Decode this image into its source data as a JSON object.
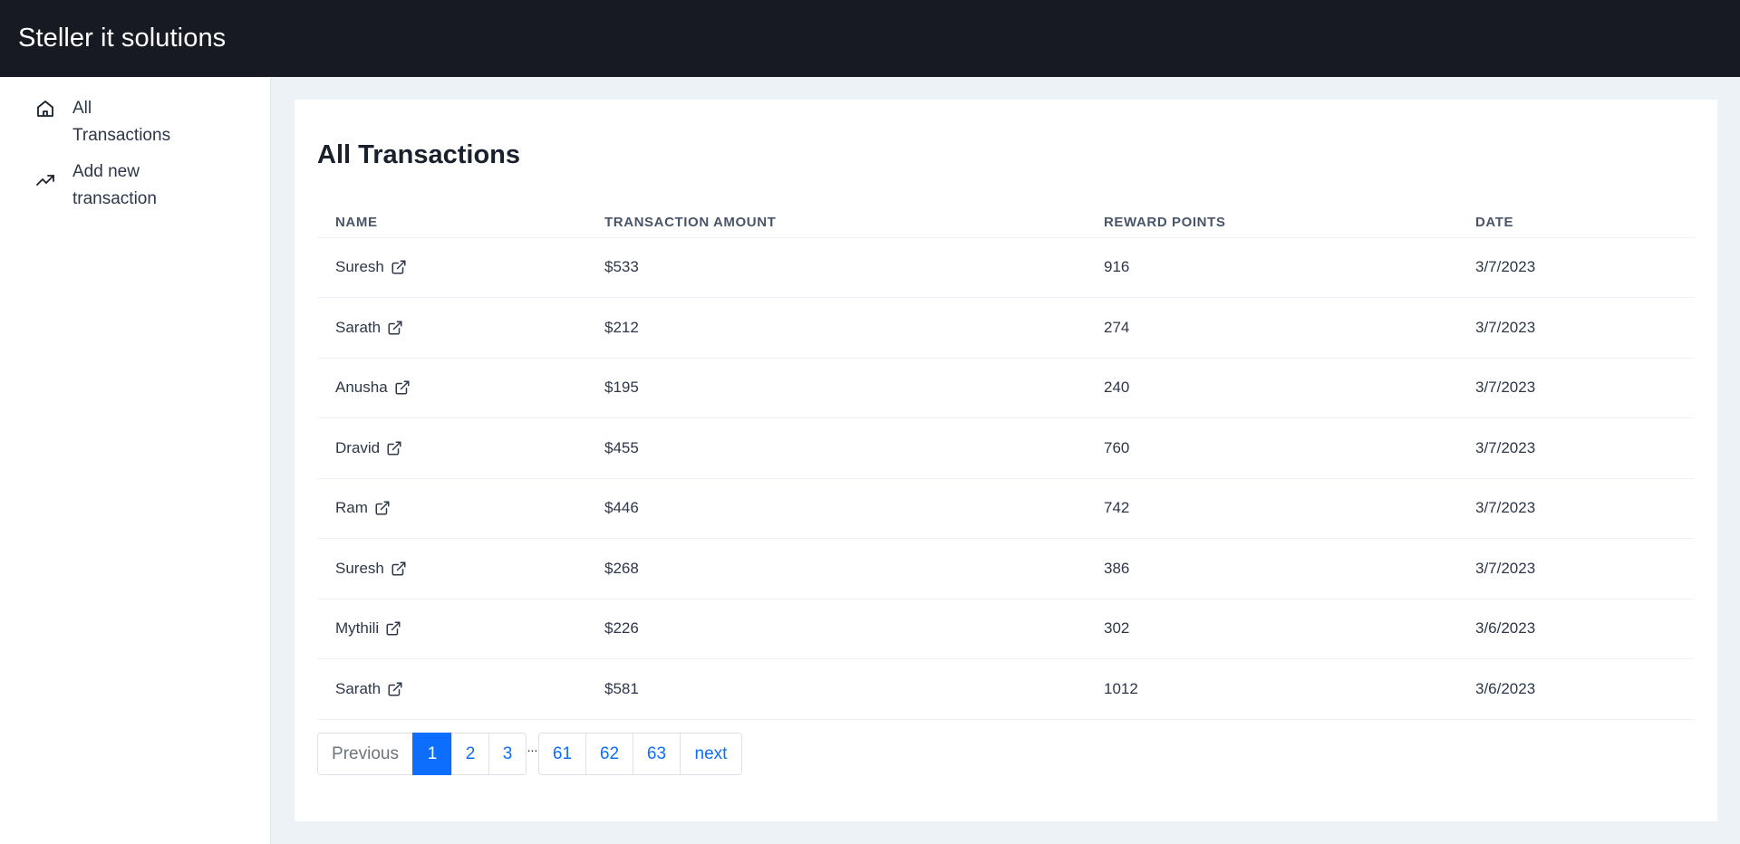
{
  "app": {
    "title": "Steller it solutions"
  },
  "sidebar": {
    "items": [
      {
        "label": "All Transactions",
        "icon": "home-icon"
      },
      {
        "label": "Add new transaction",
        "icon": "trending-up-icon"
      }
    ]
  },
  "main": {
    "title": "All Transactions",
    "columns": [
      "NAME",
      "TRANSACTION AMOUNT",
      "REWARD POINTS",
      "DATE"
    ],
    "rows": [
      {
        "name": "Suresh",
        "amount": "$533",
        "points": "916",
        "date": "3/7/2023"
      },
      {
        "name": "Sarath",
        "amount": "$212",
        "points": "274",
        "date": "3/7/2023"
      },
      {
        "name": "Anusha",
        "amount": "$195",
        "points": "240",
        "date": "3/7/2023"
      },
      {
        "name": "Dravid",
        "amount": "$455",
        "points": "760",
        "date": "3/7/2023"
      },
      {
        "name": "Ram",
        "amount": "$446",
        "points": "742",
        "date": "3/7/2023"
      },
      {
        "name": "Suresh",
        "amount": "$268",
        "points": "386",
        "date": "3/7/2023"
      },
      {
        "name": "Mythili",
        "amount": "$226",
        "points": "302",
        "date": "3/6/2023"
      },
      {
        "name": "Sarath",
        "amount": "$581",
        "points": "1012",
        "date": "3/6/2023"
      }
    ]
  },
  "pagination": {
    "previous": "Previous",
    "pages_start": [
      "1",
      "2",
      "3"
    ],
    "ellipsis": "...",
    "pages_end": [
      "61",
      "62",
      "63"
    ],
    "next": "next",
    "current": "1"
  },
  "colors": {
    "topbar": "#171923",
    "accent": "#0d6efd",
    "background": "#edf2f7"
  }
}
